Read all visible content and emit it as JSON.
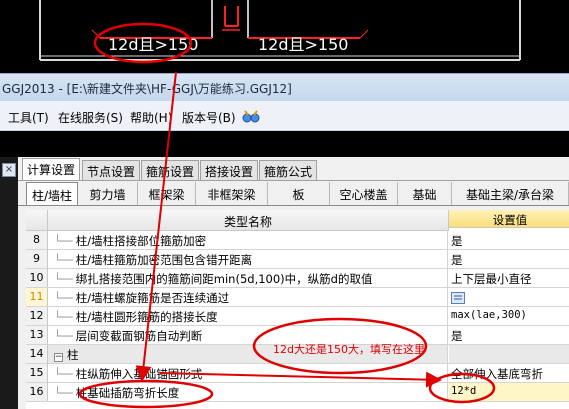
{
  "cad": {
    "labels": [
      "12d且>150",
      "12d且>150"
    ]
  },
  "window": {
    "title": "GGJ2013 - [E:\\新建文件夹\\HF-GGJ\\万能练习.GGJ12]"
  },
  "menu": {
    "items": [
      "工具(T)",
      "在线服务(S)",
      "帮助(H)",
      "版本号(B)"
    ]
  },
  "dialog": {
    "tabs": [
      "计算设置",
      "节点设置",
      "箍筋设置",
      "搭接设置",
      "箍筋公式"
    ],
    "active_tab": "计算设置",
    "sub_tabs": [
      "柱/墙柱",
      "剪力墙",
      "框架梁",
      "非框架梁",
      "板",
      "空心楼盖",
      "基础",
      "基础主梁/承台梁"
    ],
    "active_sub_tab": "柱/墙柱",
    "columns": [
      "类型名称",
      "设置值"
    ],
    "rows": [
      {
        "num": "8",
        "name": "柱/墙柱搭接部位箍筋加密",
        "value": "是"
      },
      {
        "num": "9",
        "name": "柱/墙柱箍筋加密范围包含错开距离",
        "value": "是"
      },
      {
        "num": "10",
        "name": "绑扎搭接范围内的箍筋间距min(5d,100)中，纵筋d的取值",
        "value": "上下层最小直径"
      },
      {
        "num": "11",
        "name": "柱/墙柱螺旋箍筋是否连续通过",
        "value": "是"
      },
      {
        "num": "12",
        "name": "柱/墙柱圆形箍筋的搭接长度",
        "value": "max(lae,300)"
      },
      {
        "num": "13",
        "name": "层间变截面钢筋自动判断",
        "value": "是"
      },
      {
        "num": "14",
        "name": "柱",
        "value": ""
      },
      {
        "num": "15",
        "name": "柱纵筋伸入基础锚固形式",
        "value": "全部伸入基底弯折"
      },
      {
        "num": "16",
        "name": "柱基础插筋弯折长度",
        "value": "12*d"
      }
    ]
  },
  "annotation": {
    "text": "12d大还是150大，填写在这里"
  },
  "colors": {
    "annotation_red": "#e00000",
    "header_value_bg": "#f9df7a",
    "row11_num": "#c88a00"
  }
}
